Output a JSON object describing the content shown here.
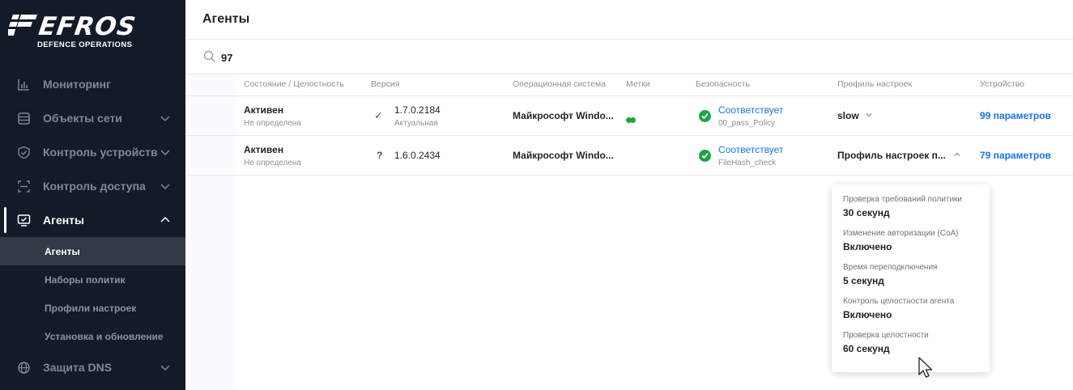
{
  "brand": {
    "name": "EFROS",
    "tagline": "DEFENCE OPERATIONS"
  },
  "sidebar": {
    "items": [
      {
        "label": "Мониторинг",
        "icon": "chart-icon"
      },
      {
        "label": "Объекты сети",
        "icon": "list-icon"
      },
      {
        "label": "Контроль устройств",
        "icon": "shield-icon"
      },
      {
        "label": "Контроль доступа",
        "icon": "scan-icon"
      },
      {
        "label": "Агенты",
        "icon": "monitor-icon"
      },
      {
        "label": "Защита DNS",
        "icon": "globe-icon"
      }
    ],
    "subitems": [
      "Агенты",
      "Наборы политик",
      "Профили настроек",
      "Установка и обновление"
    ]
  },
  "header": {
    "title": "Агенты"
  },
  "search": {
    "value": "97"
  },
  "table": {
    "columns": [
      "Состояние / Целостность",
      "Версия",
      "Операционная система",
      "Метки",
      "Безопасность",
      "Профиль настроек",
      "Устройство"
    ],
    "rows": [
      {
        "state": "Активен",
        "integrity": "Не определена",
        "version_mark": "✓",
        "version": "1.7.0.2184",
        "version_status": "Актуальная",
        "os": "Майкрософт Windo...",
        "security": "Соответствует",
        "policy": "00_pass_Policy",
        "profile": "slow",
        "device": "99 параметров"
      },
      {
        "state": "Активен",
        "integrity": "Не определена",
        "version_mark": "?",
        "version": "1.6.0.2434",
        "version_status": "",
        "os": "Майкрософт Windo...",
        "security": "Соответствует",
        "policy": "FileHash_check",
        "profile": "Профиль настроек п...",
        "device": "79 параметров"
      }
    ]
  },
  "popup": {
    "items": [
      {
        "label": "Проверка требований политики",
        "value": "30 секунд"
      },
      {
        "label": "Изменение авторизации (CoA)",
        "value": "Включено"
      },
      {
        "label": "Время переподключения",
        "value": "5 секунд"
      },
      {
        "label": "Контроль целостности агента",
        "value": "Включено"
      },
      {
        "label": "Проверка целостности",
        "value": "60 секунд"
      }
    ]
  },
  "colors": {
    "sidebar_bg": "#121b27",
    "accent_link": "#1a73e8",
    "success": "#1ea446"
  }
}
